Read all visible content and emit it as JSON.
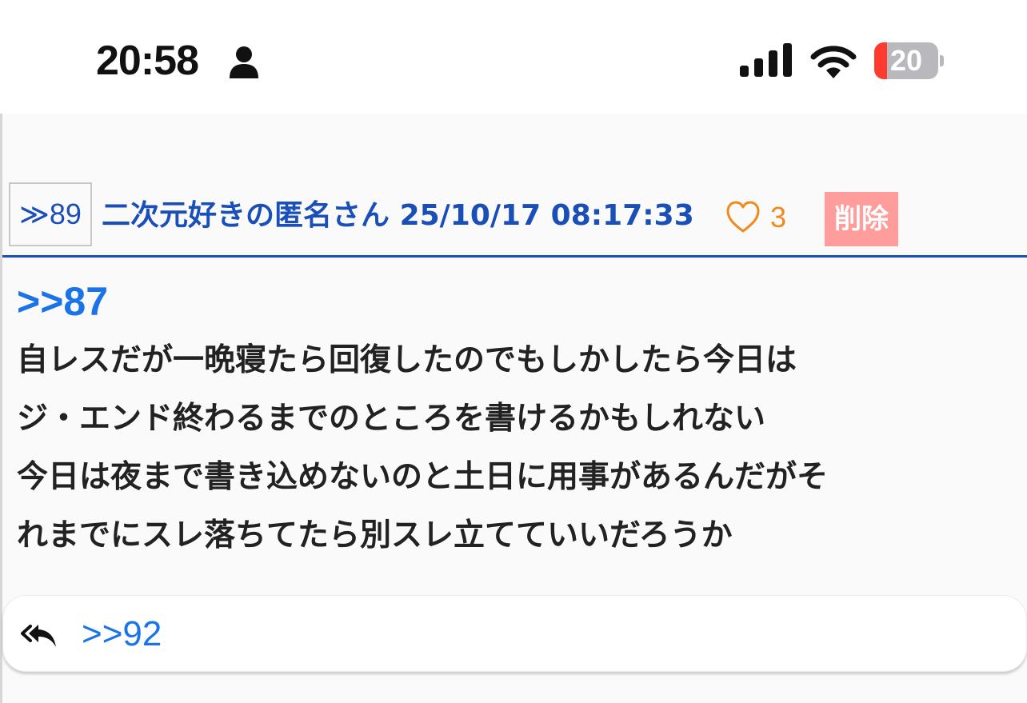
{
  "status_bar": {
    "time": "20:58",
    "battery_level": "20",
    "icons": [
      "person-icon",
      "signal-icon",
      "wifi-icon",
      "battery-icon"
    ]
  },
  "post": {
    "number": "≫89",
    "author": "二次元好きの匿名さん",
    "timestamp": "25/10/17 08:17:33",
    "likes": "3",
    "delete_label": "削除",
    "reply_to": ">>87",
    "lines": [
      "自レスだが一晩寝たら回復したのでもしかしたら今日は",
      "ジ・エンド終わるまでのところを書けるかもしれない",
      "今日は夜まで書き込めないのと土日に用事があるんだがそ",
      "れまでにスレ落ちてたら別スレ立てていいだろうか"
    ]
  },
  "replies": {
    "icon": "reply-all-icon",
    "link": ">>92"
  },
  "colors": {
    "accent_blue": "#1a4fb8",
    "link_blue": "#1a73e8",
    "like_orange": "#f08a1c",
    "delete_pink": "#ff9c9c",
    "battery_red": "#ff3b30"
  }
}
